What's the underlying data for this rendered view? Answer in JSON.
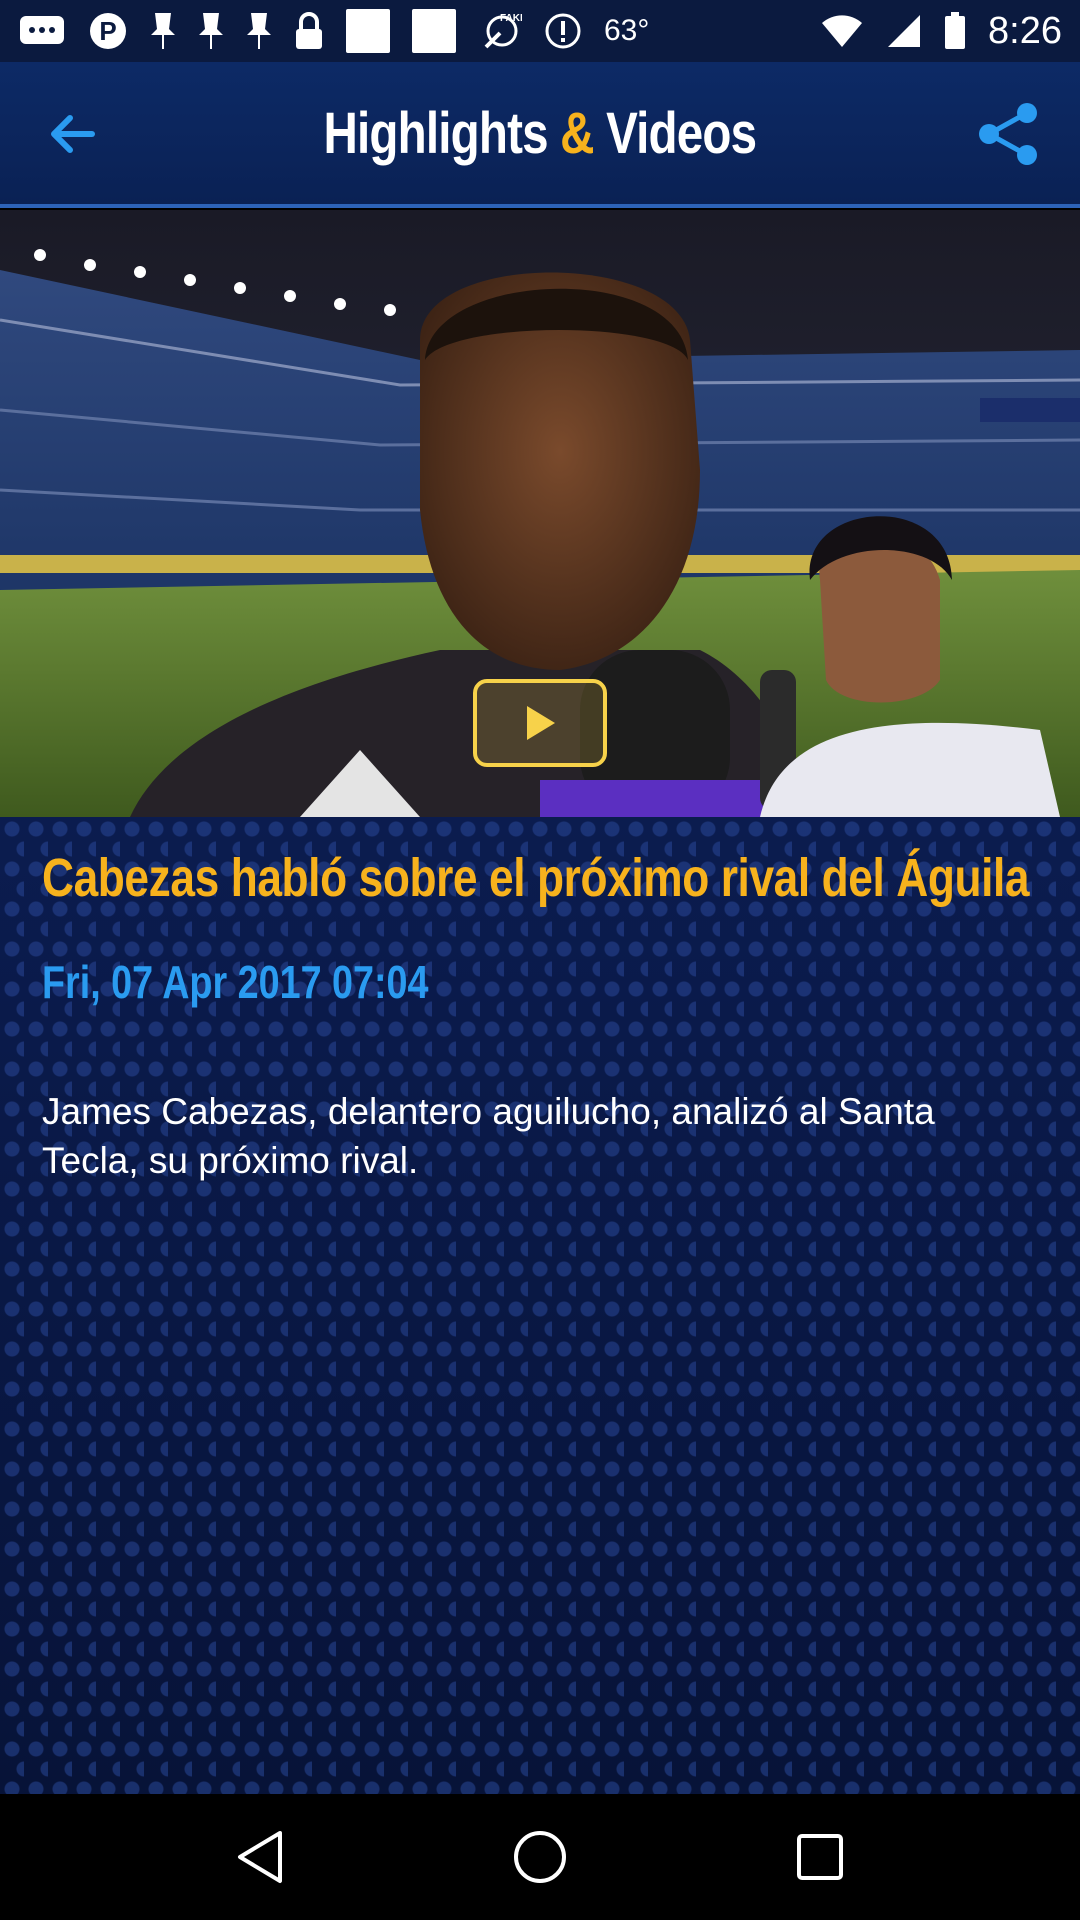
{
  "status_bar": {
    "temperature": "63°",
    "time": "8:26",
    "icons": [
      "messages-icon",
      "pinterest-icon",
      "pin-icon",
      "pin-icon",
      "pin-icon",
      "lock-icon",
      "image-icon",
      "image-icon",
      "fake-gps-icon",
      "info-icon"
    ]
  },
  "header": {
    "title_part1": "Highlights ",
    "title_amp": "&",
    "title_part2": " Videos",
    "back_icon": "back-arrow-icon",
    "share_icon": "share-icon",
    "accent_color": "#f7b21d"
  },
  "video": {
    "play_icon": "play-icon"
  },
  "article": {
    "title": "Cabezas habló sobre el próximo rival del Águila",
    "date": "Fri, 07 Apr 2017 07:04",
    "body": "James Cabezas, delantero aguilucho, analizó al Santa Tecla, su próximo rival.",
    "title_color": "#f7b21d",
    "date_color": "#2a9bf0"
  },
  "nav_bar": {
    "back_icon": "nav-back-icon",
    "home_icon": "nav-home-icon",
    "recents_icon": "nav-recents-icon"
  }
}
